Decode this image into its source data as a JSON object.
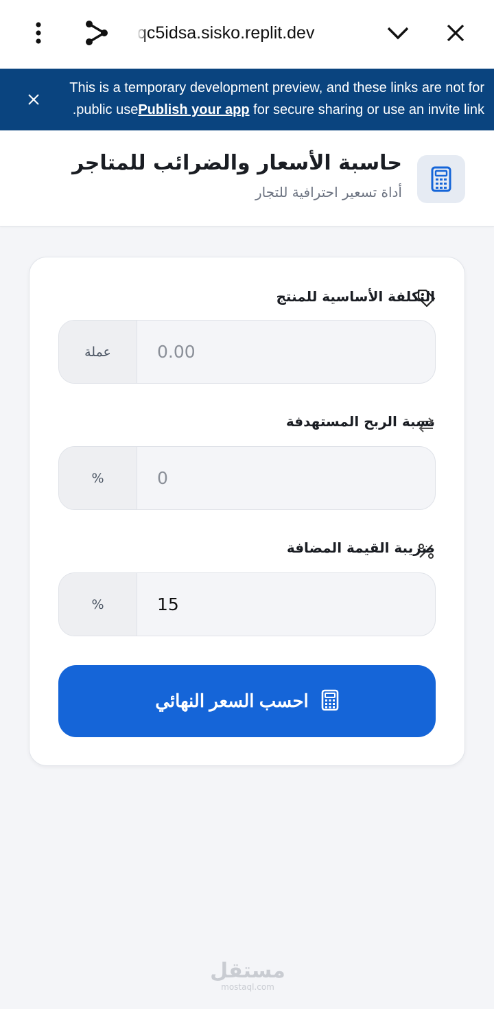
{
  "browser": {
    "url": "qc5idsa.sisko.replit.dev",
    "menu_icon": "kebab-menu-icon",
    "share_icon": "share-icon",
    "expand_icon": "chevron-down-icon",
    "close_icon": "close-icon"
  },
  "banner": {
    "text_line1": "This is a temporary development preview, and these links are not for",
    "text_pre": "public use. ",
    "link": "Publish your app",
    "text_post": " for secure sharing or use an invite link",
    "bg_color": "#0a447f"
  },
  "header": {
    "title": "حاسبة الأسعار والضرائب للمتاجر",
    "subtitle": "أداة تسعير احترافية للتجار",
    "logo_icon": "calculator-icon"
  },
  "form": {
    "cost": {
      "label": "التكلفة الأساسية للمنتج",
      "icon": "tag-icon",
      "placeholder": "0.00",
      "value": "",
      "addon": "عملة"
    },
    "profit": {
      "label": "نسبة الربح المستهدفة",
      "icon": "arrows-exchange-icon",
      "placeholder": "0",
      "value": "",
      "addon": "%"
    },
    "vat": {
      "label": "ضريبة القيمة المضافة",
      "icon": "percent-icon",
      "placeholder": "",
      "value": "15",
      "addon": "%"
    },
    "submit_label": "احسب السعر النهائي",
    "submit_color": "#1565d8"
  },
  "watermark": {
    "arabic": "مستقل",
    "latin": "mostaql.com"
  }
}
